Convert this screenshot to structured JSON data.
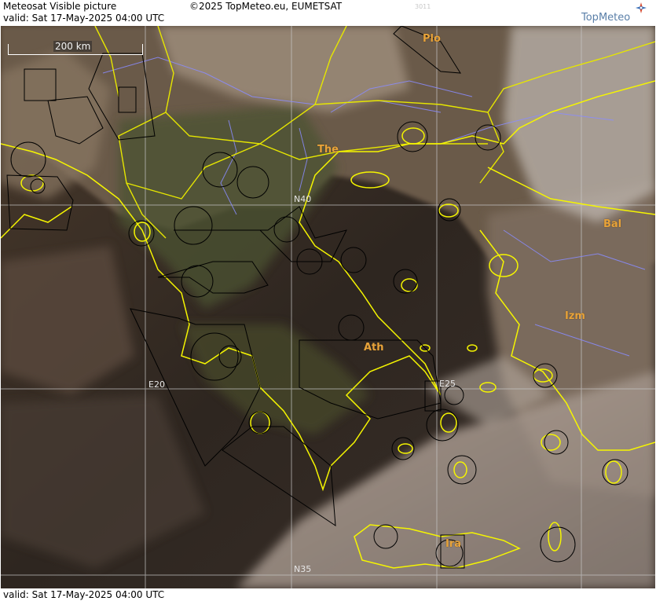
{
  "header": {
    "title": "Meteosat Visible picture",
    "valid_line": "valid:  Sat  17-May-2025  04:00 UTC",
    "copyright": "©2025 TopMeteo.eu, EUMETSAT",
    "frame_code": "3011",
    "brand": "TopMeteo"
  },
  "footer": {
    "valid_line": "valid:  Sat  17-May-2025  04:00 UTC"
  },
  "map": {
    "scale_label": "200 km",
    "cities": [
      {
        "code": "Plo"
      },
      {
        "code": "The"
      },
      {
        "code": "Bal"
      },
      {
        "code": "Izm"
      },
      {
        "code": "Ath"
      },
      {
        "code": "Ira"
      }
    ],
    "grid_labels": [
      "N40",
      "E20",
      "E25",
      "N35"
    ],
    "colors": {
      "coastline": "#f5f500",
      "borders": "#e6e600",
      "rivers": "#8a8cff",
      "grid": "#c8c8c8",
      "city": "#e8a33a",
      "zones": "#000000"
    }
  }
}
